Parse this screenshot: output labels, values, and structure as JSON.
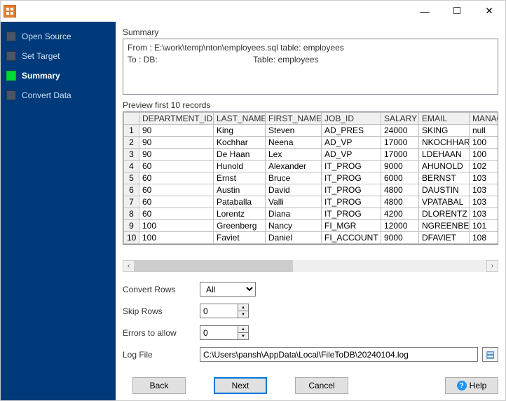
{
  "window": {
    "minimize": "—",
    "maximize": "☐",
    "close": "✕"
  },
  "sidebar": {
    "steps": [
      {
        "label": "Open Source",
        "active": false
      },
      {
        "label": "Set Target",
        "active": false
      },
      {
        "label": "Summary",
        "active": true
      },
      {
        "label": "Convert Data",
        "active": false
      }
    ]
  },
  "summary": {
    "heading": "Summary",
    "line1": "From : E:\\work\\temp\\nton\\employees.sql table: employees",
    "line2_left": "To : DB:",
    "line2_right": "Table: employees"
  },
  "preview": {
    "heading": "Preview first 10 records",
    "columns": [
      "DEPARTMENT_ID",
      "LAST_NAME",
      "FIRST_NAME",
      "JOB_ID",
      "SALARY",
      "EMAIL",
      "MANAG"
    ],
    "rows": [
      [
        "90",
        "King",
        "Steven",
        "AD_PRES",
        "24000",
        "SKING",
        "null"
      ],
      [
        "90",
        "Kochhar",
        "Neena",
        "AD_VP",
        "17000",
        "NKOCHHAR",
        "100"
      ],
      [
        "90",
        "De Haan",
        "Lex",
        "AD_VP",
        "17000",
        "LDEHAAN",
        "100"
      ],
      [
        "60",
        "Hunold",
        "Alexander",
        "IT_PROG",
        "9000",
        "AHUNOLD",
        "102"
      ],
      [
        "60",
        "Ernst",
        "Bruce",
        "IT_PROG",
        "6000",
        "BERNST",
        "103"
      ],
      [
        "60",
        "Austin",
        "David",
        "IT_PROG",
        "4800",
        "DAUSTIN",
        "103"
      ],
      [
        "60",
        "Pataballa",
        "Valli",
        "IT_PROG",
        "4800",
        "VPATABAL",
        "103"
      ],
      [
        "60",
        "Lorentz",
        "Diana",
        "IT_PROG",
        "4200",
        "DLORENTZ",
        "103"
      ],
      [
        "100",
        "Greenberg",
        "Nancy",
        "FI_MGR",
        "12000",
        "NGREENBE",
        "101"
      ],
      [
        "100",
        "Faviet",
        "Daniel",
        "FI_ACCOUNT",
        "9000",
        "DFAVIET",
        "108"
      ]
    ]
  },
  "form": {
    "convert_rows_label": "Convert Rows",
    "convert_rows_value": "All",
    "skip_rows_label": "Skip Rows",
    "skip_rows_value": "0",
    "errors_label": "Errors to allow",
    "errors_value": "0",
    "logfile_label": "Log File",
    "logfile_value": "C:\\Users\\pansh\\AppData\\Local\\FileToDB\\20240104.log"
  },
  "buttons": {
    "back": "Back",
    "next": "Next",
    "cancel": "Cancel",
    "help": "Help"
  }
}
